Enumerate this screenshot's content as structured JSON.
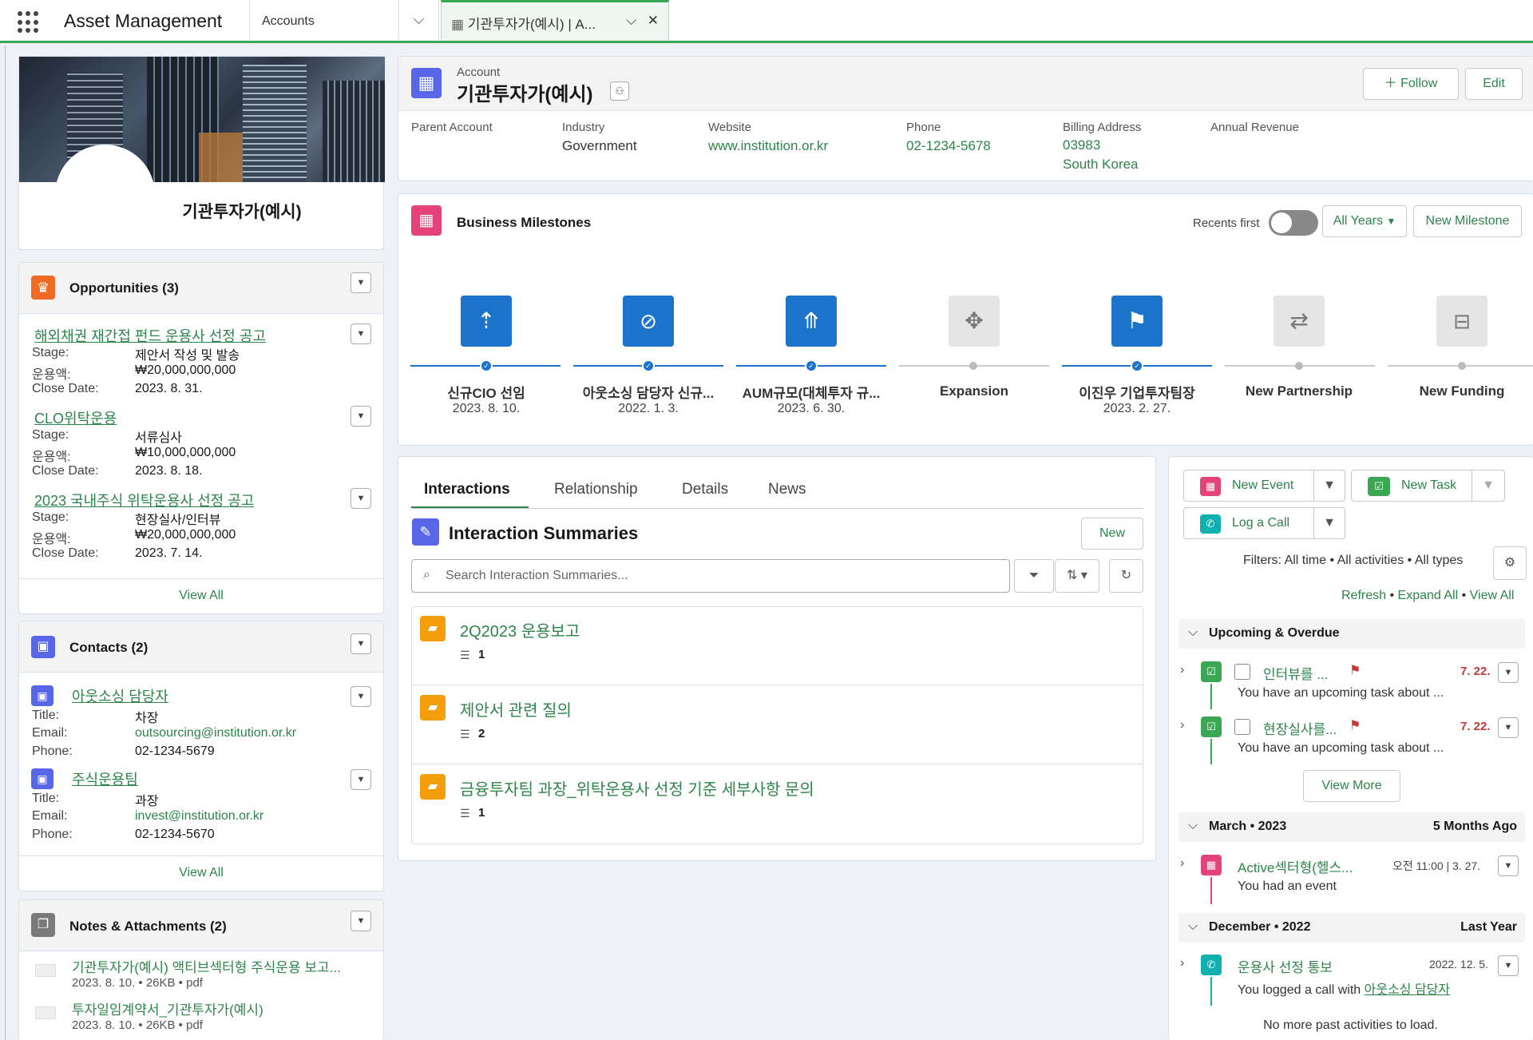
{
  "topbar": {
    "app_name": "Asset Management",
    "nav_item": "Accounts",
    "tab_label": "기관투자가(예시) | A..."
  },
  "profile": {
    "name": "기관투자가(예시)"
  },
  "opportunities": {
    "title": "Opportunities (3)",
    "items": [
      {
        "name": "해외채권 재간접 펀드 운용사 선정 공고",
        "stage": "제안서 작성 및 발송",
        "amount": "₩20,000,000,000",
        "close": "2023. 8. 31."
      },
      {
        "name": "CLO위탁운용",
        "stage": "서류심사",
        "amount": "₩10,000,000,000",
        "close": "2023. 8. 18."
      },
      {
        "name": "2023 국내주식 위탁운용사 선정 공고",
        "stage": "현장실사/인터뷰",
        "amount": "₩20,000,000,000",
        "close": "2023. 7. 14."
      }
    ],
    "labels": {
      "stage": "Stage:",
      "amount": "운용액:",
      "close": "Close Date:"
    },
    "view_all": "View All"
  },
  "contacts": {
    "title": "Contacts (2)",
    "items": [
      {
        "name": "아웃소싱 담당자",
        "title": "차장",
        "email": "outsourcing@institution.or.kr",
        "phone": "02-1234-5679"
      },
      {
        "name": "주식운용팀",
        "title": "과장",
        "email": "invest@institution.or.kr",
        "phone": "02-1234-5670"
      }
    ],
    "labels": {
      "title": "Title:",
      "email": "Email:",
      "phone": "Phone:"
    },
    "view_all": "View All"
  },
  "notes": {
    "title": "Notes & Attachments (2)",
    "items": [
      {
        "name": "기관투자가(예시) 액티브섹터형 주식운용 보고...",
        "meta": "2023. 8. 10. • 26KB • pdf"
      },
      {
        "name": "투자일임계약서_기관투자가(예시)",
        "meta": "2023. 8. 10. • 26KB • pdf"
      }
    ]
  },
  "account": {
    "type_label": "Account",
    "name": "기관투자가(예시)",
    "follow": "Follow",
    "edit": "Edit",
    "fields": {
      "parent_label": "Parent Account",
      "parent": "",
      "industry_label": "Industry",
      "industry": "Government",
      "website_label": "Website",
      "website": "www.institution.or.kr",
      "phone_label": "Phone",
      "phone": "02-1234-5678",
      "billing_label": "Billing Address",
      "billing_1": "03983",
      "billing_2": "South Korea",
      "revenue_label": "Annual Revenue",
      "revenue": ""
    }
  },
  "milestones": {
    "title": "Business Milestones",
    "recents": "Recents first",
    "years": "All Years",
    "new": "New Milestone",
    "items": [
      {
        "name": "신규CIO 선임",
        "date": "2023. 8. 10."
      },
      {
        "name": "아웃소싱 담당자 신규...",
        "date": "2022. 1. 3."
      },
      {
        "name": "AUM규모(대체투자 규...",
        "date": "2023. 6. 30."
      },
      {
        "name": "Expansion",
        "date": ""
      },
      {
        "name": "이진우 기업투자팀장",
        "date": "2023. 2. 27."
      },
      {
        "name": "New Partnership",
        "date": ""
      },
      {
        "name": "New Funding",
        "date": ""
      }
    ]
  },
  "interactions": {
    "tabs": [
      "Interactions",
      "Relationship",
      "Details",
      "News"
    ],
    "title": "Interaction Summaries",
    "new": "New",
    "search_placeholder": "Search Interaction Summaries...",
    "items": [
      {
        "name": "2Q2023 운용보고",
        "count": "1"
      },
      {
        "name": "제안서 관련 질의",
        "count": "2"
      },
      {
        "name": "금융투자팀 과장_위탁운용사 선정 기준 세부사항 문의",
        "count": "1"
      }
    ]
  },
  "activity": {
    "new_event": "New Event",
    "new_task": "New Task",
    "log_call": "Log a Call",
    "filters": "Filters: All time • All activities • All types",
    "refresh": "Refresh",
    "expand": "Expand All",
    "view_all": "View All",
    "upcoming": "Upcoming & Overdue",
    "tasks": [
      {
        "name": "인터뷰를 ...",
        "date": "7. 22.",
        "desc": "You have an upcoming task about ..."
      },
      {
        "name": "현장실사를...",
        "date": "7. 22.",
        "desc": "You have an upcoming task about ..."
      }
    ],
    "view_more": "View More",
    "march": "March • 2023",
    "march_ago": "5 Months Ago",
    "event": {
      "name": "Active섹터형(헬스...",
      "date": "오전 11:00 | 3. 27.",
      "desc": "You had an event"
    },
    "december": "December • 2022",
    "december_ago": "Last Year",
    "call": {
      "name": "운용사 선정 통보",
      "date": "2022. 12. 5.",
      "desc": "You logged a call with",
      "with": "아웃소싱 담당자"
    },
    "no_more": "No more past activities to load."
  },
  "colors": {
    "accent": "#2e844a",
    "blue": "#1b74c9",
    "orange": "#f06a24"
  }
}
